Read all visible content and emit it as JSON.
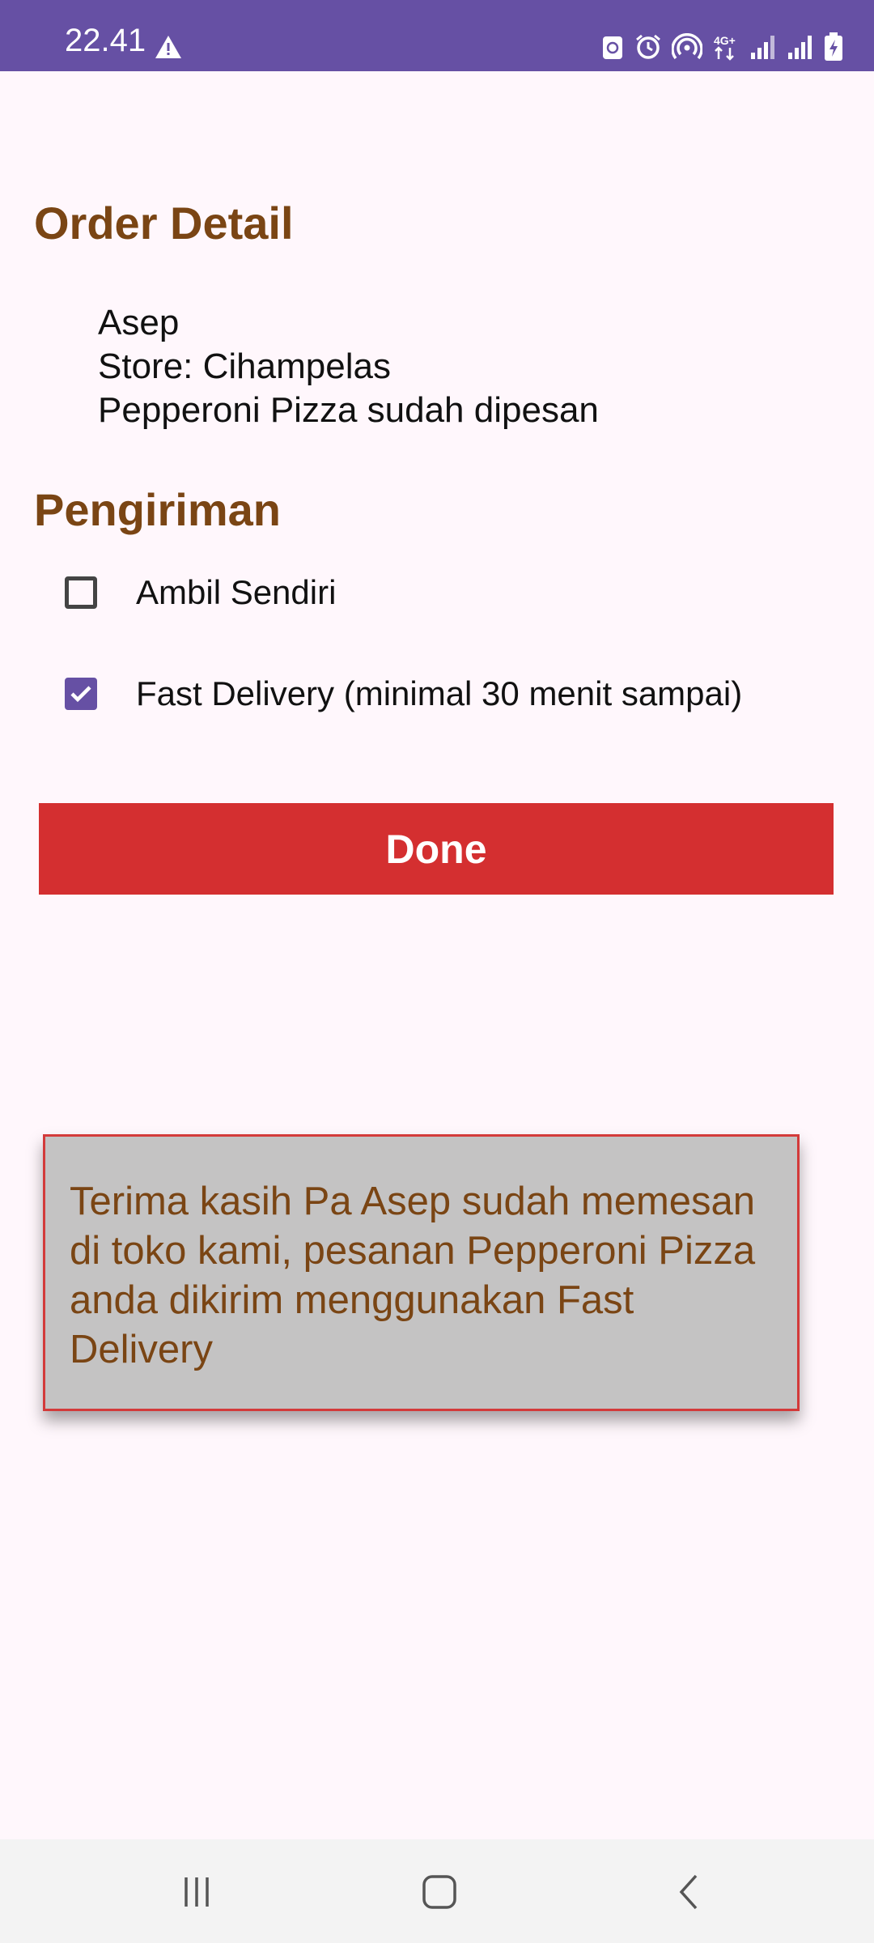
{
  "status_bar": {
    "time": "22.41",
    "icons": [
      "warning-icon",
      "recycle-icon",
      "alarm-icon",
      "hotspot-icon",
      "4g-icon",
      "signal-icon",
      "signal-icon",
      "battery-charging-icon"
    ],
    "network_label": "4G+"
  },
  "order_detail": {
    "heading": "Order Detail",
    "name": "Asep",
    "store": "Store: Cihampelas",
    "item": "Pepperoni Pizza sudah dipesan"
  },
  "shipping": {
    "heading": "Pengiriman",
    "options": [
      {
        "label": "Ambil Sendiri",
        "checked": false
      },
      {
        "label": "Fast Delivery (minimal 30 menit sampai)",
        "checked": true
      }
    ]
  },
  "done_button": {
    "label": "Done"
  },
  "message": {
    "text": "Terima kasih Pa Asep sudah memesan di toko kami, pesanan Pepperoni Pizza anda dikirim menggunakan Fast Delivery"
  },
  "colors": {
    "status_bar": "#6650a4",
    "heading": "#7a4514",
    "button": "#d42f30",
    "checkbox_checked": "#6650a4",
    "message_bg": "#c4c3c3",
    "message_border": "#d33a3a"
  },
  "nav_bar": {
    "icons": [
      "recent-apps-icon",
      "home-icon",
      "back-icon"
    ]
  }
}
